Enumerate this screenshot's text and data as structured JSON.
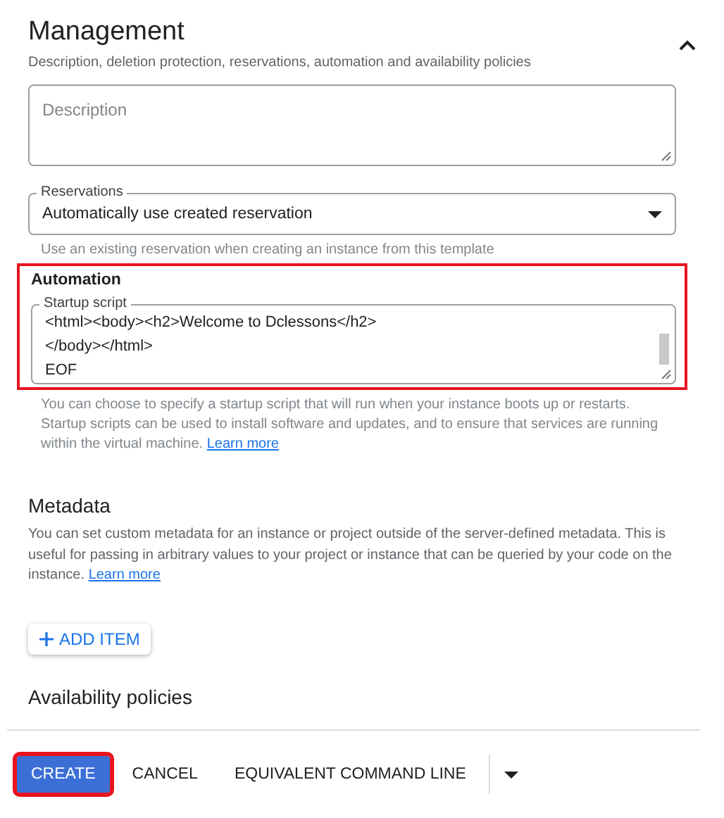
{
  "section": {
    "title": "Management",
    "subtitle": "Description, deletion protection, reservations, automation and availability policies",
    "expanded": true
  },
  "description": {
    "placeholder": "Description"
  },
  "reservations": {
    "label": "Reservations",
    "value": "Automatically use created reservation",
    "helper": "Use an existing reservation when creating an instance from this template"
  },
  "automation": {
    "title": "Automation",
    "highlighted": true,
    "field_label": "Startup script",
    "lines": [
      "<html><body><h2>Welcome to Dclessons</h2>",
      "</body></html>",
      "EOF"
    ],
    "helper": "You can choose to specify a startup script that will run when your instance boots up or restarts. Startup scripts can be used to install software and updates, and to ensure that services are running within the virtual machine.",
    "link": "Learn more"
  },
  "metadata": {
    "title": "Metadata",
    "text": "You can set custom metadata for an instance or project outside of the server-defined metadata. This is useful for passing in arbitrary values to your project or instance that can be queried by your code on the instance.",
    "link": "Learn more",
    "button": "ADD ITEM"
  },
  "availability": {
    "title": "Availability policies"
  },
  "footer": [
    {
      "kind": "primary",
      "label": "CREATE",
      "highlighted": true
    },
    {
      "kind": "text",
      "label": "CANCEL",
      "highlighted": false
    },
    {
      "kind": "text",
      "label": "EQUIVALENT COMMAND LINE",
      "highlighted": false
    },
    {
      "kind": "menu",
      "highlighted": false
    }
  ]
}
